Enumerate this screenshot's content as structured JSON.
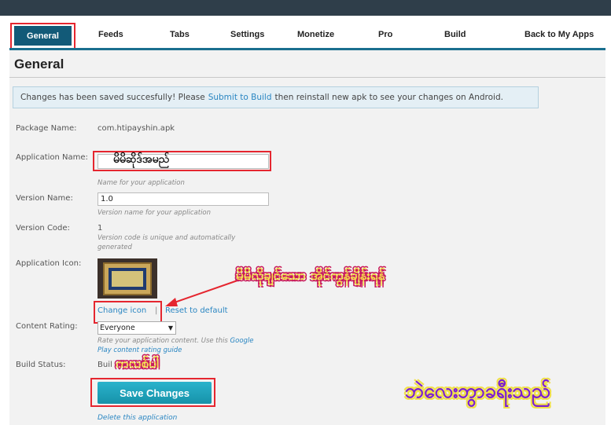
{
  "tabs": {
    "general": "General",
    "feeds": "Feeds",
    "tabs": "Tabs",
    "settings": "Settings",
    "monetize": "Monetize",
    "pro": "Pro",
    "build": "Build",
    "back": "Back to My Apps"
  },
  "page_title": "General",
  "notice": {
    "before": "Changes has been saved succesfully! Please",
    "link": "Submit to Build",
    "after": "then reinstall new apk to see your changes on Android."
  },
  "form": {
    "package_label": "Package Name:",
    "package_value": "com.htipayshin.apk",
    "app_name_label": "Application Name:",
    "app_name_hint": "Name for your application",
    "version_name_label": "Version Name:",
    "version_name_value": "1.0",
    "version_name_hint": "Version name for your application",
    "version_code_label": "Version Code:",
    "version_code_value": "1",
    "version_code_hint1": "Version code is unique and automatically",
    "version_code_hint2": "generated",
    "icon_label": "Application Icon:",
    "change_icon": "Change icon",
    "reset_default": "Reset to default",
    "rating_label": "Content Rating:",
    "rating_value": "Everyone",
    "rating_hint1": "Rate your application content. Use this",
    "rating_hint_link1": "Google",
    "rating_hint_link2": "Play content rating",
    "rating_hint_link3": "guide",
    "build_status_label": "Build Status:",
    "build_status_value": "Buil",
    "save_button": "Save Changes",
    "delete_link": "Delete this application"
  },
  "annotations": {
    "app_name_text": "မိမိဆိုဒ်အမည်",
    "icon_note": "မိမိလိုချင်သော အိုင်ကွန်ချိန်းရန်",
    "click_note": "ကလစ်ပါ",
    "bottom_note": "ဘဲလေးဘွာခရီးသည်"
  },
  "colors": {
    "nav_accent": "#125a78",
    "highlight": "#e5262f",
    "button": "#1ea3bb",
    "link": "#2a86c2"
  }
}
